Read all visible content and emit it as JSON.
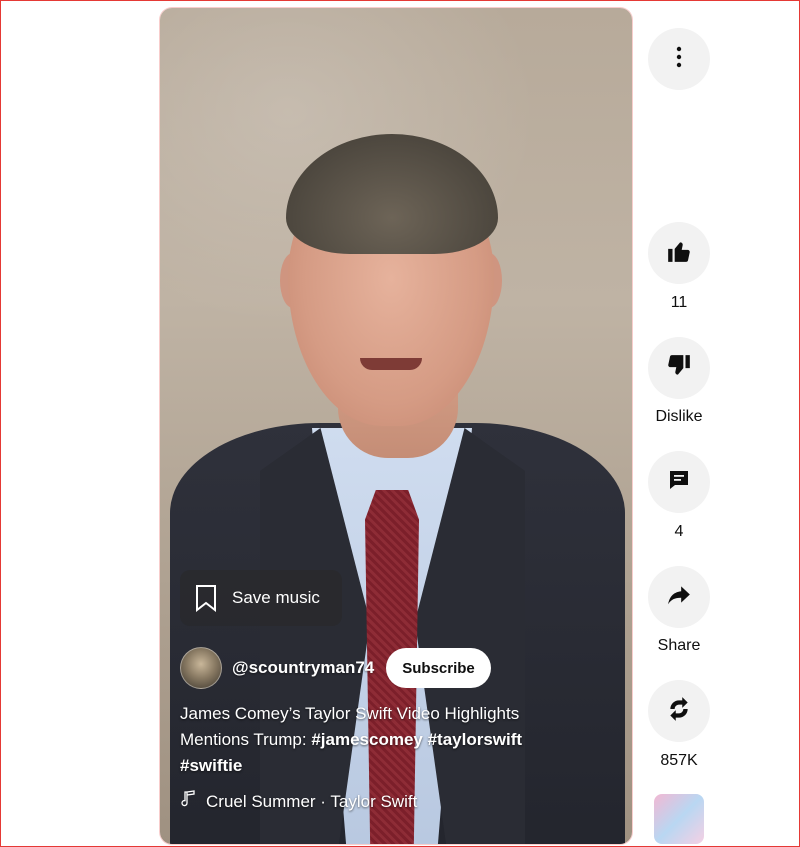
{
  "save_music": {
    "label": "Save music"
  },
  "channel": {
    "handle": "@scountryman74",
    "subscribe_label": "Subscribe"
  },
  "video_title": {
    "text": "James Comey’s Taylor Swift Video Highlights Mentions Trump: ",
    "hashtags": [
      "#jamescomey",
      "#taylorswift",
      "#swiftie"
    ]
  },
  "music": {
    "track": "Cruel Summer · Taylor Swift"
  },
  "actions": {
    "like_count": "11",
    "dislike_label": "Dislike",
    "comment_count": "4",
    "share_label": "Share",
    "remix_count": "857K"
  },
  "icons": [
    "more-vertical-icon",
    "thumbs-up-icon",
    "thumbs-down-icon",
    "comment-icon",
    "share-icon",
    "remix-icon",
    "bookmark-icon",
    "music-note-icon"
  ],
  "colors": {
    "accent_red": "#e53935",
    "button_bg": "#f2f2f2",
    "text_dark": "#0f0f0f"
  }
}
